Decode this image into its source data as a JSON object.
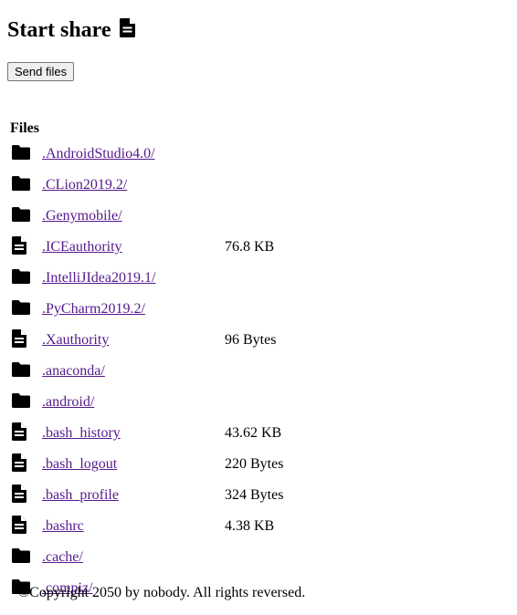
{
  "page": {
    "title": "Start share",
    "title_icon": "file-icon",
    "send_button_label": "Send files"
  },
  "files_table": {
    "header": "Files",
    "rows": [
      {
        "type": "folder",
        "icon": "folder-icon",
        "name": ".AndroidStudio4.0/",
        "size": ""
      },
      {
        "type": "folder",
        "icon": "folder-icon",
        "name": ".CLion2019.2/",
        "size": ""
      },
      {
        "type": "folder",
        "icon": "folder-icon",
        "name": ".Genymobile/",
        "size": ""
      },
      {
        "type": "file",
        "icon": "file-icon",
        "name": ".ICEauthority",
        "size": "76.8 KB"
      },
      {
        "type": "folder",
        "icon": "folder-icon",
        "name": ".IntelliJIdea2019.1/",
        "size": ""
      },
      {
        "type": "folder",
        "icon": "folder-icon",
        "name": ".PyCharm2019.2/",
        "size": ""
      },
      {
        "type": "file",
        "icon": "file-icon",
        "name": ".Xauthority",
        "size": "96 Bytes"
      },
      {
        "type": "folder",
        "icon": "folder-icon",
        "name": ".anaconda/",
        "size": ""
      },
      {
        "type": "folder",
        "icon": "folder-icon",
        "name": ".android/",
        "size": ""
      },
      {
        "type": "file",
        "icon": "file-icon",
        "name": ".bash_history",
        "size": "43.62 KB"
      },
      {
        "type": "file",
        "icon": "file-icon",
        "name": ".bash_logout",
        "size": "220 Bytes"
      },
      {
        "type": "file",
        "icon": "file-icon",
        "name": ".bash_profile",
        "size": "324 Bytes"
      },
      {
        "type": "file",
        "icon": "file-icon",
        "name": ".bashrc",
        "size": "4.38 KB"
      },
      {
        "type": "folder",
        "icon": "folder-icon",
        "name": ".cache/",
        "size": ""
      },
      {
        "type": "folder",
        "icon": "folder-icon",
        "name": ".compiz/",
        "size": ""
      }
    ]
  },
  "footer": {
    "text": "©Copyright 2050 by nobody. All rights reversed."
  },
  "colors": {
    "link": "#551a8b",
    "text": "#000000",
    "background": "#ffffff"
  }
}
